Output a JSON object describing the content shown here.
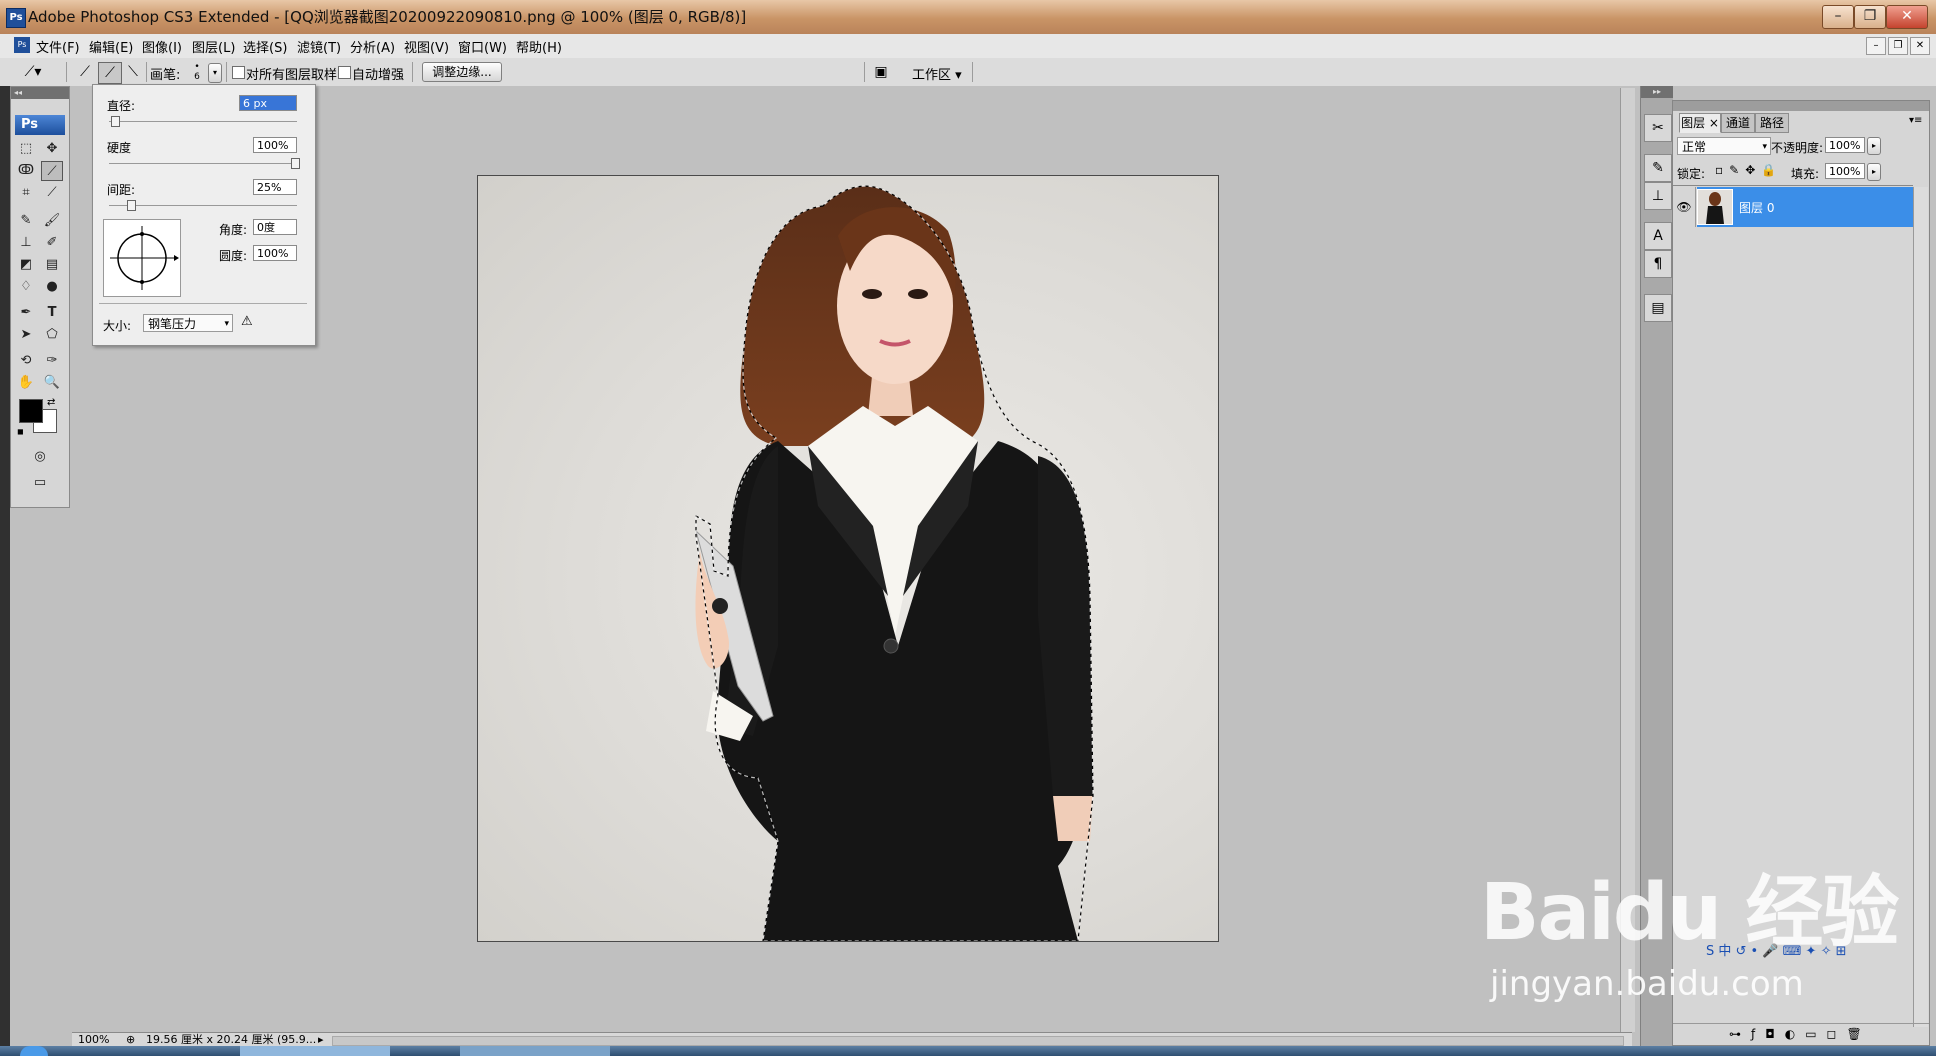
{
  "titlebar": {
    "app_title": "Adobe Photoshop CS3 Extended - [QQ浏览器截图20200922090810.png @ 100% (图层 0, RGB/8)]",
    "logo": "Ps"
  },
  "menu": [
    "文件(F)",
    "编辑(E)",
    "图像(I)",
    "图层(L)",
    "选择(S)",
    "滤镜(T)",
    "分析(A)",
    "视图(V)",
    "窗口(W)",
    "帮助(H)"
  ],
  "options": {
    "brush_label": "画笔:",
    "brush_size": "6",
    "sample_all_layers": "对所有图层取样",
    "auto_enhance": "自动增强",
    "refine_edge_button": "调整边缘...",
    "workspace_label": "工作区 ▾"
  },
  "brush_popup": {
    "diameter_label": "直径:",
    "diameter_value": "6 px",
    "hardness_label": "硬度",
    "hardness_value": "100%",
    "spacing_label": "间距:",
    "spacing_value": "25%",
    "angle_label": "角度:",
    "angle_value": "0度",
    "roundness_label": "圆度:",
    "roundness_value": "100%",
    "size_label": "大小:",
    "size_option": "钢笔压力"
  },
  "layers_panel": {
    "tabs": [
      "图层 ×",
      "通道",
      "路径"
    ],
    "blend_mode": "正常",
    "opacity_label": "不透明度:",
    "opacity_value": "100%",
    "lock_label": "锁定:",
    "fill_label": "填充:",
    "fill_value": "100%",
    "layer_name": "图层 0"
  },
  "status": {
    "zoom": "100%",
    "doc_info": "19.56 厘米 x 20.24 厘米 (95.9..."
  },
  "watermark": {
    "logo": "Baidu 经验",
    "url": "jingyan.baidu.com"
  },
  "colors": {
    "foreground": "#000000",
    "background": "#ffffff",
    "layer_selected": "#3b8ee8",
    "title_gradient": "#c99466"
  }
}
